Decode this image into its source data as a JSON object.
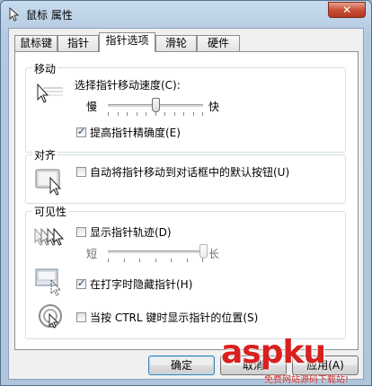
{
  "window": {
    "title": "鼠标 属性",
    "close_glyph": "✕"
  },
  "tabs": [
    {
      "label": "鼠标键",
      "active": false
    },
    {
      "label": "指针",
      "active": false
    },
    {
      "label": "指针选项",
      "active": true
    },
    {
      "label": "滑轮",
      "active": false
    },
    {
      "label": "硬件",
      "active": false
    }
  ],
  "motion": {
    "group_label": "移动",
    "speed_label": "选择指针移动速度(C):",
    "slow_label": "慢",
    "fast_label": "快",
    "speed_value": 0.5,
    "precision_label": "提高指针精确度(E)",
    "precision_checked": true,
    "icon": "pointer-speed-icon"
  },
  "snap": {
    "group_label": "对齐",
    "snap_label": "自动将指针移动到对话框中的默认按钮(U)",
    "snap_checked": false,
    "icon": "snap-to-button-icon"
  },
  "visibility": {
    "group_label": "可见性",
    "trails_label": "显示指针轨迹(D)",
    "trails_checked": false,
    "short_label": "短",
    "long_label": "长",
    "trail_value": 1.0,
    "hide_label": "在打字时隐藏指针(H)",
    "hide_checked": true,
    "ctrl_label": "当按 CTRL 键时显示指针的位置(S)",
    "ctrl_checked": false,
    "icons": [
      "pointer-trails-icon",
      "hide-while-typing-icon",
      "ctrl-locate-icon"
    ]
  },
  "buttons": {
    "ok": "确定",
    "cancel": "取消",
    "apply": "应用(A)"
  },
  "watermark": {
    "brand": "aspku",
    "tagline": "免费网站源码下载站!"
  },
  "check_mark": "✓"
}
